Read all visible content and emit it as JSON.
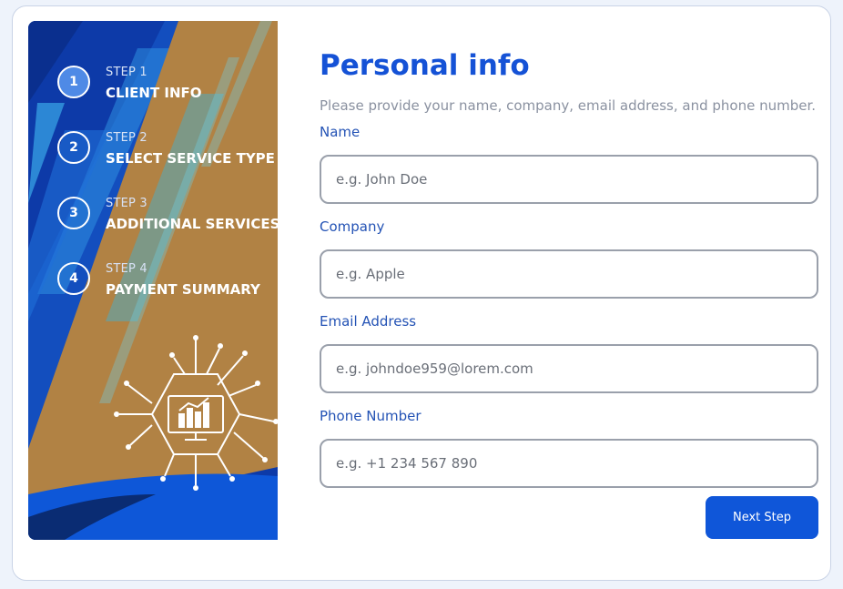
{
  "sidebar": {
    "steps": [
      {
        "number": "1",
        "label": "STEP 1",
        "title": "CLIENT INFO",
        "active": true
      },
      {
        "number": "2",
        "label": "STEP 2",
        "title": "SELECT SERVICE TYPE",
        "active": false
      },
      {
        "number": "3",
        "label": "STEP 3",
        "title": "ADDITIONAL SERVICES",
        "active": false
      },
      {
        "number": "4",
        "label": "STEP 4",
        "title": "PAYMENT SUMMARY",
        "active": false
      }
    ],
    "illustration_icon": "monitor-analytics-circuit-icon"
  },
  "form": {
    "title": "Personal info",
    "description": "Please provide your name, company, email address, and phone number.",
    "fields": [
      {
        "label": "Name",
        "value": "",
        "placeholder": "e.g. John Doe"
      },
      {
        "label": "Company",
        "value": "",
        "placeholder": "e.g. Apple"
      },
      {
        "label": "Email Address",
        "value": "",
        "placeholder": "e.g. johndoe959@lorem.com"
      },
      {
        "label": "Phone Number",
        "value": "",
        "placeholder": "e.g. +1 234 567 890"
      }
    ],
    "next_label": "Next Step"
  },
  "colors": {
    "accent": "#0f56d9",
    "title": "#1552d6",
    "sidebar_blue": "#0d3aa8",
    "sidebar_tan": "#b18244"
  }
}
